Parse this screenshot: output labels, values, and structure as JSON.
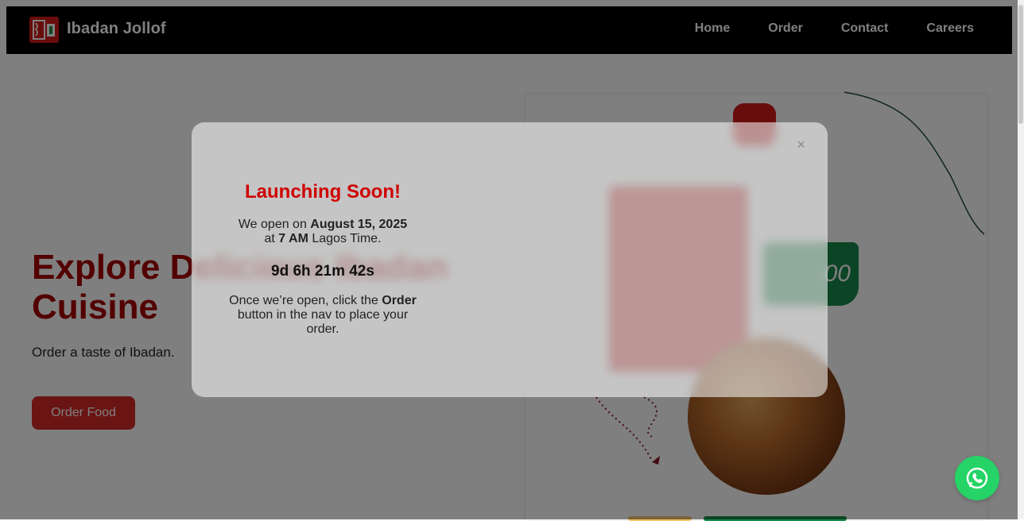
{
  "brand": {
    "name": "Ibadan Jollof",
    "color": "#d21818"
  },
  "nav": {
    "items": [
      {
        "label": "Home"
      },
      {
        "label": "Order"
      },
      {
        "label": "Contact"
      },
      {
        "label": "Careers"
      }
    ]
  },
  "hero": {
    "title": "Explore Delicious Ibadan Cuisine",
    "subtitle": "Order a taste of Ibadan.",
    "cta_label": "Order Food",
    "accent": "#a60000"
  },
  "modal": {
    "title": "Launching Soon!",
    "line1_prefix": "We open on ",
    "line1_date": "August 15, 2025",
    "line2_prefix": "at ",
    "line2_time": "7 AM",
    "line2_suffix": " Lagos Time.",
    "countdown": "9d 6h 21m 42s",
    "footer_prefix": "Once we’re open, click the ",
    "footer_order": "Order",
    "footer_suffix": " button in the nav to place your order.",
    "close_label": "×"
  },
  "promo": {
    "price_text": "00"
  },
  "icons": {
    "whatsapp": "whatsapp-icon",
    "logo": "ibadan-jollof-logo"
  },
  "colors": {
    "nav_bg": "#000000",
    "title_red": "#d00000",
    "whatsapp_green": "#25d366"
  }
}
